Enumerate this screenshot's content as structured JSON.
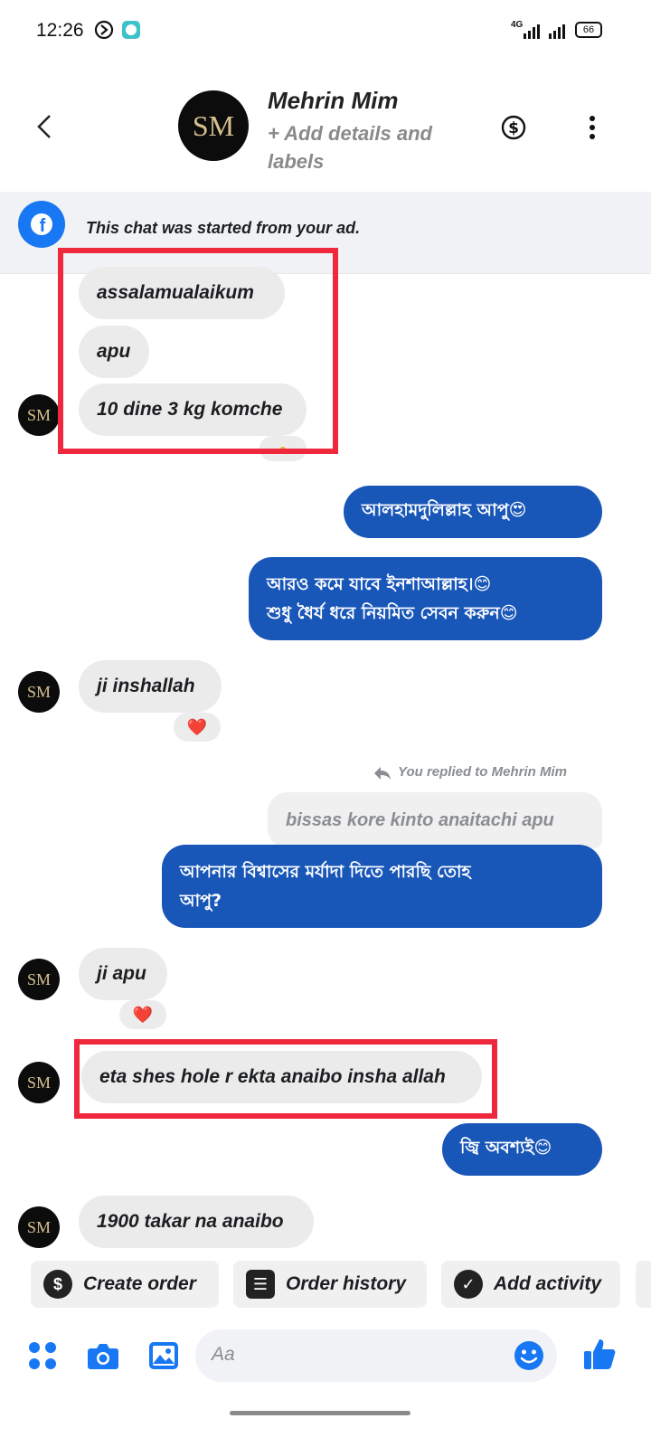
{
  "status_bar": {
    "time": "12:26",
    "network": "4G",
    "battery": "66"
  },
  "header": {
    "avatar_initials": "SM",
    "contact_name": "Mehrin Mim",
    "subtitle": "+ Add details and labels"
  },
  "banner": {
    "text": "This chat was started from your ad."
  },
  "messages": {
    "m1": "assalamualaikum",
    "m2": "apu",
    "m3": "10 dine 3 kg komche",
    "m4": "আলহামদুলিল্লাহ আপু😍",
    "m5_line1": "আরও কমে যাবে ইনশাআল্লাহ।😊",
    "m5_line2": "শুধু ধৈর্য ধরে নিয়মিত সেবন করুন😊",
    "m6": "ji inshallah",
    "replied_label": "You replied to Mehrin Mim",
    "m7_quote": "bissas kore kinto anaitachi apu",
    "m7_line1": "আপনার বিশ্বাসের মর্যাদা দিতে পারছি তোহ",
    "m7_line2": "আপু?",
    "m8": "ji apu",
    "m9": "eta shes hole r ekta anaibo insha allah",
    "m10": "জ্বি অবশ্যই😊",
    "m11": "1900 takar na anaibo"
  },
  "reactions": {
    "heart": "❤️"
  },
  "quick_actions": {
    "create_order": "Create order",
    "order_history": "Order history",
    "add_activity": "Add activity"
  },
  "composer": {
    "placeholder": "Aa"
  },
  "colors": {
    "accent": "#1856b8",
    "highlight": "#f0283e",
    "facebook_blue": "#1877f2"
  }
}
